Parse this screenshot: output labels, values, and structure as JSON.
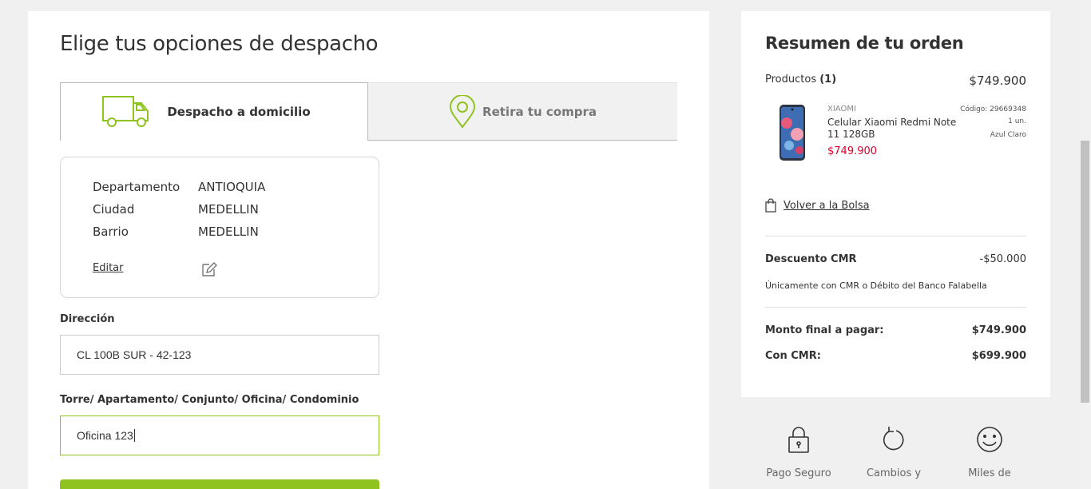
{
  "checkout": {
    "title": "Elige tus opciones de despacho",
    "tabs": [
      {
        "label": "Despacho a domicilio",
        "icon": "truck-icon"
      },
      {
        "label": "Retira tu compra",
        "icon": "location-pin-icon"
      }
    ],
    "location": {
      "rows": [
        {
          "key": "Departamento",
          "value": "ANTIOQUIA"
        },
        {
          "key": "Ciudad",
          "value": "MEDELLIN"
        },
        {
          "key": "Barrio",
          "value": "MEDELLIN"
        }
      ],
      "edit_label": "Editar",
      "edit_icon": "edit-icon"
    },
    "address": {
      "label": "Dirección",
      "value": "CL 100B SUR - 42-123"
    },
    "tower": {
      "label": "Torre/ Apartamento/ Conjunto/ Oficina/ Condominio",
      "value": "Oficina 123"
    },
    "accent_color": "#8fc31f"
  },
  "summary": {
    "title": "Resumen de tu orden",
    "products_label": "Productos",
    "products_count": "(1)",
    "products_total": "$749.900",
    "product": {
      "brand": "XIAOMI",
      "name": "Celular Xiaomi Redmi Note 11 128GB",
      "price": "$749.900",
      "code": "Código: 29669348",
      "qty": "1 un.",
      "color": "Azul Claro"
    },
    "back_label": "Volver a la Bolsa",
    "discount_label": "Descuento CMR",
    "discount_value": "-$50.000",
    "discount_note": "Únicamente con CMR o Débito del Banco Falabella",
    "final_label": "Monto final a pagar:",
    "final_value": "$749.900",
    "cmr_label": "Con CMR:",
    "cmr_value": "$699.900",
    "price_color": "#e4002b"
  },
  "trust": [
    {
      "label": "Pago Seguro",
      "icon": "lock-icon"
    },
    {
      "label": "Cambios y",
      "icon": "refresh-icon"
    },
    {
      "label": "Miles de",
      "icon": "smiley-icon"
    }
  ]
}
